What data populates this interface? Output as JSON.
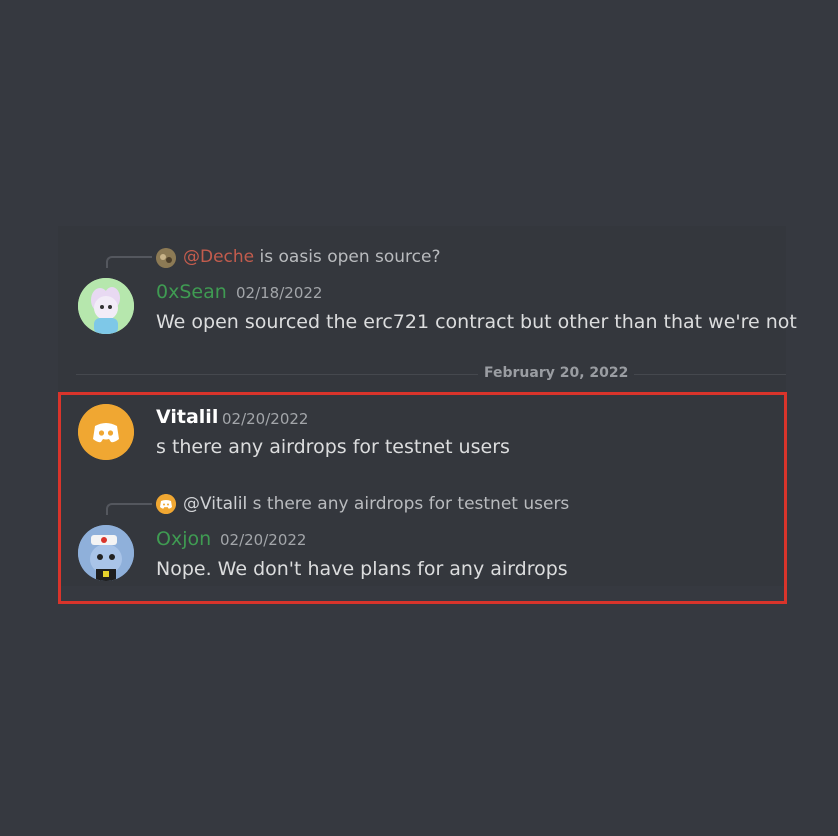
{
  "messages": [
    {
      "reply": {
        "mention": "@Deche",
        "text": "is oasis open source?"
      },
      "username": "0xSean",
      "timestamp": "02/18/2022",
      "text": "We open sourced the erc721 contract but other than that we're not",
      "name_color": "#3f9b52"
    },
    {
      "username": "Vitalil",
      "timestamp": "02/20/2022",
      "text": "s there any airdrops for testnet users",
      "name_color": "#ffffff",
      "avatar_color": "#f0a732"
    },
    {
      "reply": {
        "mention": "@Vitalil",
        "text": "s there any airdrops for testnet users"
      },
      "username": "Oxjon",
      "timestamp": "02/20/2022",
      "text": "Nope. We don't have plans for any airdrops",
      "name_color": "#3f9b52"
    }
  ],
  "divider": {
    "label": "February 20, 2022"
  },
  "highlight_color": "#d9342b",
  "background_color": "#363940"
}
